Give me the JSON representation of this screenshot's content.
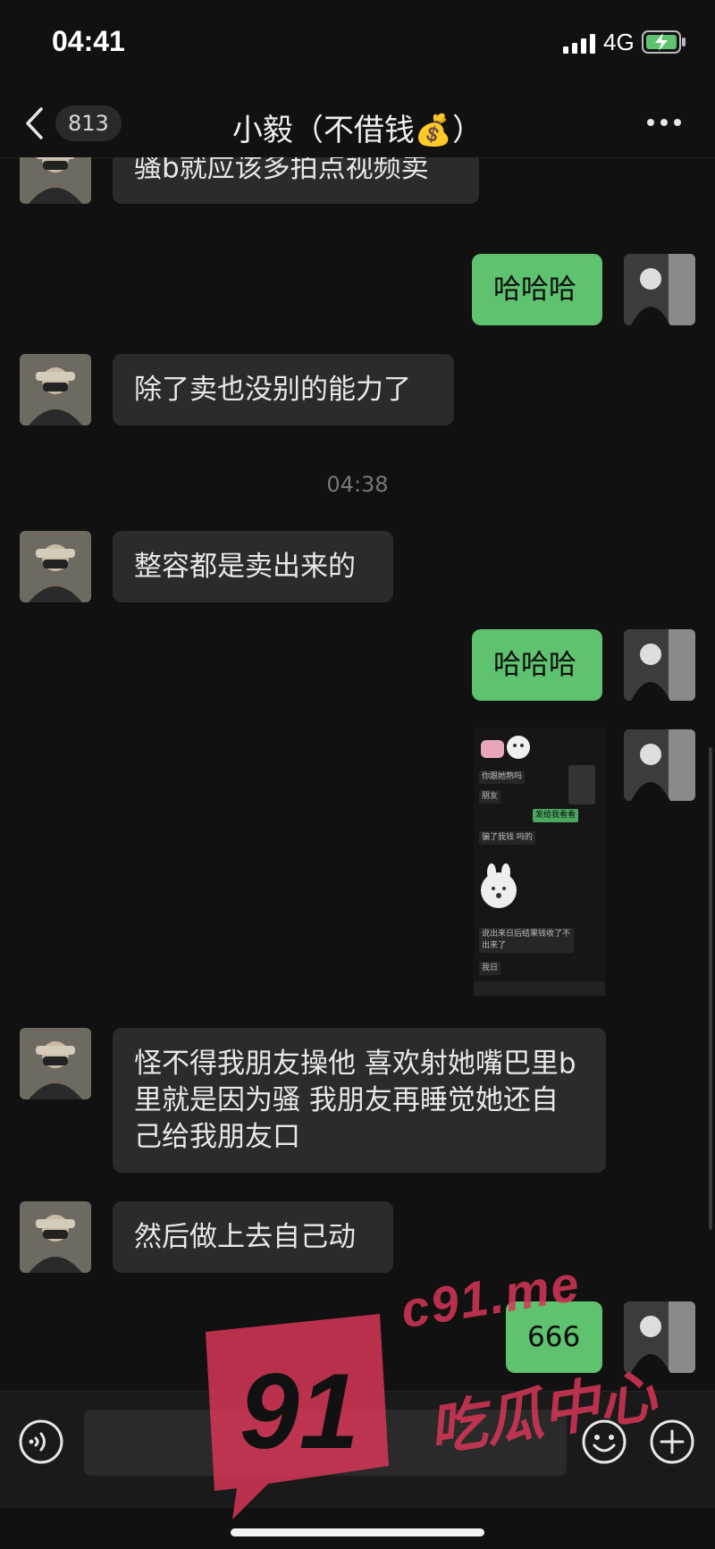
{
  "status": {
    "time": "04:41",
    "network": "4G"
  },
  "nav": {
    "unread_count": "813",
    "title": "小毅（不借钱💰）"
  },
  "messages": [
    {
      "from": "contact",
      "text": "骚b就应该多拍点视频卖"
    },
    {
      "from": "me",
      "text": "哈哈哈"
    },
    {
      "from": "contact",
      "text": "除了卖也没别的能力了"
    },
    {
      "from": "contact",
      "text": "整容都是卖出来的"
    },
    {
      "from": "me",
      "text": "哈哈哈"
    },
    {
      "from": "contact",
      "text": "怪不得我朋友操他 喜欢射她嘴巴里b里就是因为骚 我朋友再睡觉她还自己给我朋友口"
    },
    {
      "from": "contact",
      "text": "然后做上去自己动"
    },
    {
      "from": "me",
      "text": "666"
    }
  ],
  "timestamp": "04:38",
  "screenshot": {
    "lines": [
      "你跟她熟吗",
      "朋友",
      "发给我看看",
      "骗了我钱 吗的",
      "说出来日后结果钱收了不出来了",
      "我日"
    ]
  },
  "watermark": {
    "url": "c91.me",
    "name": "吃瓜中心",
    "logo_number": "91"
  },
  "colors": {
    "background": "#111111",
    "incoming_bubble": "#2b2b2b",
    "outgoing_bubble": "#5ec26f",
    "watermark": "#d63656"
  }
}
